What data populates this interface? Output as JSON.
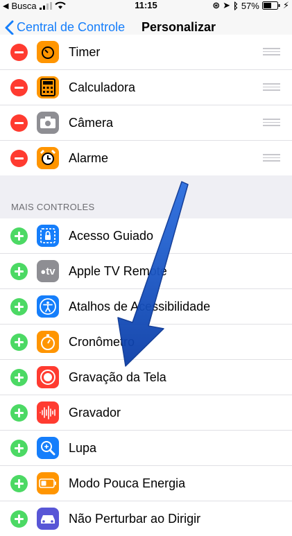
{
  "status": {
    "carrier": "Busca",
    "time": "11:15",
    "battery": "57%"
  },
  "nav": {
    "back_label": "Central de Controle",
    "title": "Personalizar"
  },
  "included": [
    {
      "label": "Timer",
      "icon": "timer-icon",
      "color": "#ff9500"
    },
    {
      "label": "Calculadora",
      "icon": "calculator-icon",
      "color": "#ff9500"
    },
    {
      "label": "Câmera",
      "icon": "camera-icon",
      "color": "#8e8e93"
    },
    {
      "label": "Alarme",
      "icon": "alarm-icon",
      "color": "#ff9500"
    }
  ],
  "more_controls": {
    "header": "MAIS CONTROLES",
    "items": [
      {
        "label": "Acesso Guiado",
        "icon": "guided-access-icon",
        "color": "#157efb"
      },
      {
        "label": "Apple TV Remote",
        "icon": "apple-tv-icon",
        "color": "#8e8e93",
        "icon_text": "tv"
      },
      {
        "label": "Atalhos de Acessibilidade",
        "icon": "accessibility-icon",
        "color": "#157efb"
      },
      {
        "label": "Cronômetro",
        "icon": "stopwatch-icon",
        "color": "#ff9500"
      },
      {
        "label": "Gravação da Tela",
        "icon": "screen-recording-icon",
        "color": "#ff3b30"
      },
      {
        "label": "Gravador",
        "icon": "voice-memo-icon",
        "color": "#ff3b30"
      },
      {
        "label": "Lupa",
        "icon": "magnifier-icon",
        "color": "#157efb"
      },
      {
        "label": "Modo Pouca Energia",
        "icon": "low-power-icon",
        "color": "#ff9500"
      },
      {
        "label": "Não Perturbar ao Dirigir",
        "icon": "car-icon",
        "color": "#5856d6"
      }
    ]
  }
}
